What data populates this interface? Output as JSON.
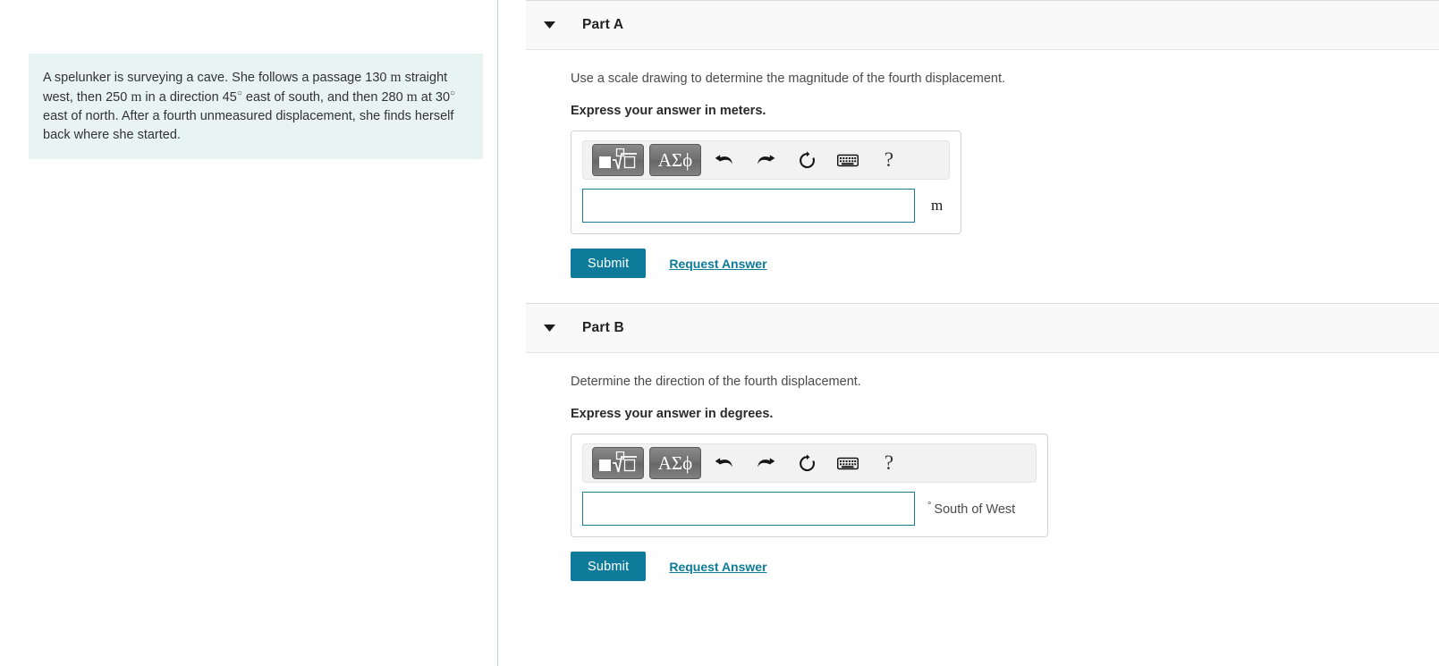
{
  "problem": {
    "text_segments": [
      {
        "t": "A spelunker is surveying a cave. She follows a passage 130 ",
        "style": "plain"
      },
      {
        "t": "m",
        "style": "math"
      },
      {
        "t": " straight west, then 250 ",
        "style": "plain"
      },
      {
        "t": "m",
        "style": "math"
      },
      {
        "t": " in a direction 45",
        "style": "plain"
      },
      {
        "t": "°",
        "style": "sup"
      },
      {
        "t": " east of south, and then 280 ",
        "style": "plain"
      },
      {
        "t": "m",
        "style": "math"
      },
      {
        "t": " at 30",
        "style": "plain"
      },
      {
        "t": "°",
        "style": "sup"
      },
      {
        "t": " east of north. After a fourth unmeasured displacement, she finds herself back where she started.",
        "style": "plain"
      }
    ],
    "full_text": "A spelunker is surveying a cave. She follows a passage 130 m straight west, then 250 m in a direction 45° east of south, and then 280 m at 30° east of north. After a fourth unmeasured displacement, she finds herself back where she started.",
    "background_color": "#e8f4f3"
  },
  "colors": {
    "accent_teal": "#0d7b99",
    "input_border": "#1a7c96",
    "panel_header_bg": "#f9f9f9",
    "toolbar_bg": "#f2f2f2",
    "divider": "#c3ced6"
  },
  "toolbar": {
    "buttons": [
      {
        "name": "math-template-button",
        "label": "√",
        "type": "template"
      },
      {
        "name": "greek-symbols-button",
        "label": "ΑΣϕ",
        "type": "greek"
      },
      {
        "name": "undo-icon",
        "label": "undo",
        "type": "icon"
      },
      {
        "name": "redo-icon",
        "label": "redo",
        "type": "icon"
      },
      {
        "name": "reset-icon",
        "label": "reset",
        "type": "icon"
      },
      {
        "name": "keyboard-icon",
        "label": "keyboard",
        "type": "icon"
      },
      {
        "name": "help-icon",
        "label": "?",
        "type": "icon"
      }
    ],
    "greek_label": "ΑΣϕ",
    "help_label": "?"
  },
  "parts": [
    {
      "id": "A",
      "title": "Part A",
      "question": "Use a scale drawing to determine the magnitude of the fourth displacement.",
      "express": "Express your answer in meters.",
      "input_value": "",
      "input_placeholder": "",
      "unit": "m",
      "unit_suffix": "",
      "submit_label": "Submit",
      "request_label": "Request Answer"
    },
    {
      "id": "B",
      "title": "Part B",
      "question": "Determine the direction of the fourth displacement.",
      "express": "Express your answer in degrees.",
      "input_value": "",
      "input_placeholder": "",
      "unit": "°",
      "unit_suffix": "South of West",
      "submit_label": "Submit",
      "request_label": "Request Answer"
    }
  ]
}
